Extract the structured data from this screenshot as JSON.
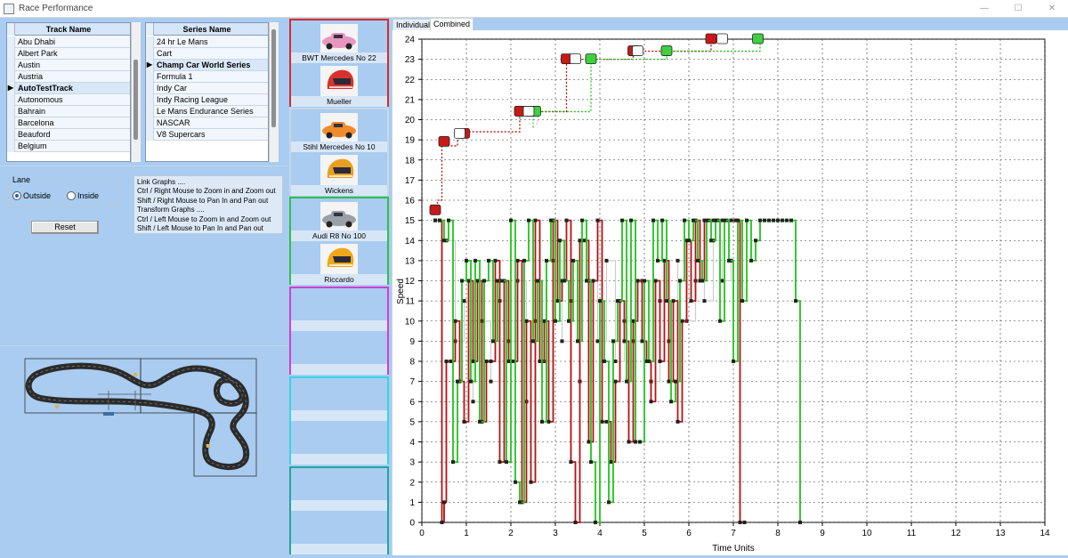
{
  "window": {
    "title": "Race Performance",
    "controls": [
      "—",
      "☐",
      "✕"
    ]
  },
  "track_list": {
    "header": "Track Name",
    "items": [
      "Abu Dhabi",
      "Albert Park",
      "Austin",
      "Austria",
      "AutoTestTrack",
      "Autonomous",
      "Bahrain",
      "Barcelona",
      "Beauford",
      "Belgium"
    ],
    "selected_index": 4
  },
  "series_list": {
    "header": "Series Name",
    "items": [
      "24 hr Le Mans",
      "Cart",
      "Champ Car World Series",
      "Formula 1",
      "Indy Car",
      "Indy Racing League",
      "Le Mans Endurance Series",
      "NASCAR",
      "V8 Supercars"
    ],
    "selected_index": 2
  },
  "lane": {
    "legend": "Lane",
    "options": [
      "Outside",
      "Inside"
    ],
    "selected": "Outside"
  },
  "reset_label": "Reset",
  "help_lines": [
    "Link Graphs ....",
    "Ctrl / Right Mouse to Zoom in and Zoom out",
    "Shift / Right Mouse to Pan In and Pan out",
    "Transform Graphs ....",
    "Ctrl / Left Mouse to Zoom in and Zoom out",
    "Shift / Left Mouse to Pan In and Pan out"
  ],
  "cars": [
    {
      "car": "BWT Mercedes No 22",
      "driver": "Mueller",
      "border": "#d62b2b",
      "car_color": "#e896c0",
      "helmet_color": "#d8322e"
    },
    {
      "car": "Stihl Mercedes No 10",
      "driver": "Wickens",
      "border": "#c9d7e6",
      "car_color": "#f08c2c",
      "helmet_color": "#e8a020"
    },
    {
      "car": "Audi R8 No 100",
      "driver": "Riccardo",
      "border": "#2ec24a",
      "car_color": "#9aa0a8",
      "helmet_color": "#f0a818"
    }
  ],
  "empty_slots": [
    {
      "border": "#d23fd2"
    },
    {
      "border": "#39d4e4"
    },
    {
      "border": "#21a6a0"
    }
  ],
  "tabs": [
    "Individual",
    "Combined"
  ],
  "active_tab": "Combined",
  "colors": {
    "background": "#a9ccf0",
    "series_red": "#b31212",
    "series_green": "#22c21e",
    "series_grey": "#c8cec8"
  },
  "chart_data": {
    "type": "line",
    "xlabel": "Time Units",
    "ylabel": "Speed",
    "xlim": [
      0,
      14
    ],
    "ylim": [
      0,
      24
    ],
    "xticks": [
      0,
      1,
      2,
      3,
      4,
      5,
      6,
      7,
      8,
      9,
      10,
      11,
      12,
      13,
      14
    ],
    "yticks": [
      0,
      1,
      2,
      3,
      4,
      5,
      6,
      7,
      8,
      9,
      10,
      11,
      12,
      13,
      14,
      15,
      16,
      17,
      18,
      19,
      20,
      21,
      22,
      23,
      24
    ],
    "grid": true,
    "series": [
      {
        "color": "#b31212",
        "x": [
          0.3,
          0.4,
          0.45,
          0.5,
          0.55,
          0.65,
          0.75,
          0.85,
          0.95,
          1.05,
          1.15,
          1.25,
          1.35,
          1.45,
          1.55,
          1.65,
          1.75,
          1.85,
          1.95,
          2.05,
          2.15,
          2.25,
          2.35,
          2.45,
          2.55,
          2.65,
          2.75,
          2.85,
          2.95,
          3.05,
          3.15,
          3.25,
          3.35,
          3.45,
          3.55,
          3.65,
          3.75,
          3.85,
          3.95,
          4.05,
          4.15,
          4.25,
          4.35,
          4.45,
          4.55,
          4.65,
          4.75,
          4.85,
          4.95,
          5.05,
          5.15,
          5.25,
          5.35,
          5.45,
          5.55,
          5.65,
          5.75,
          5.85,
          5.95,
          6.05,
          6.15,
          6.25,
          6.35,
          6.45,
          6.55,
          6.65,
          6.75,
          6.85,
          6.95,
          7.05,
          7.15,
          7.25
        ],
        "y": [
          15,
          15,
          0,
          1,
          8,
          8,
          10,
          7,
          5,
          12,
          8,
          12,
          5,
          8,
          8,
          13,
          3,
          12,
          8,
          8,
          13,
          1,
          10,
          2,
          15,
          8,
          10,
          5,
          15,
          11,
          12,
          15,
          3,
          0,
          14,
          14,
          4,
          12,
          15,
          5,
          5,
          3,
          7,
          11,
          9,
          4,
          10,
          12,
          9,
          8,
          6,
          12,
          8,
          13,
          7,
          11,
          5,
          10,
          14,
          11,
          15,
          12,
          15,
          15,
          15,
          15,
          15,
          15,
          15,
          15,
          0,
          0
        ]
      },
      {
        "color": "#22c21e",
        "x": [
          0.3,
          0.4,
          0.5,
          0.6,
          0.7,
          0.8,
          0.9,
          1.0,
          1.1,
          1.2,
          1.3,
          1.4,
          1.5,
          1.6,
          1.7,
          1.8,
          1.9,
          2.0,
          2.1,
          2.2,
          2.3,
          2.4,
          2.5,
          2.6,
          2.7,
          2.8,
          2.9,
          3.0,
          3.1,
          3.2,
          3.3,
          3.4,
          3.5,
          3.6,
          3.7,
          3.8,
          3.9,
          4.0,
          4.1,
          4.2,
          4.3,
          4.4,
          4.5,
          4.6,
          4.7,
          4.8,
          4.9,
          5.0,
          5.1,
          5.2,
          5.3,
          5.4,
          5.5,
          5.6,
          5.7,
          5.8,
          5.9,
          6.0,
          6.1,
          6.2,
          6.3,
          6.4,
          6.5,
          6.6,
          6.7,
          6.8,
          6.9,
          7.0,
          7.1,
          7.2,
          7.3,
          7.4,
          7.5,
          7.6,
          7.7,
          7.8,
          7.9,
          8.0,
          8.1,
          8.2,
          8.3,
          8.4,
          8.5
        ],
        "y": [
          15,
          15,
          14,
          15,
          3,
          7,
          12,
          13,
          7,
          13,
          5,
          12,
          13,
          9,
          12,
          12,
          3,
          15,
          2,
          1,
          13,
          15,
          9,
          12,
          5,
          13,
          15,
          10,
          14,
          12,
          10,
          13,
          9,
          15,
          12,
          3,
          0,
          11,
          8,
          1,
          9,
          11,
          15,
          7,
          15,
          4,
          4,
          12,
          8,
          15,
          13,
          15,
          11,
          6,
          7,
          12,
          15,
          14,
          15,
          13,
          12,
          15,
          14,
          15,
          10,
          15,
          13,
          8,
          15,
          11,
          15,
          13,
          14,
          15,
          15,
          15,
          15,
          15,
          15,
          15,
          15,
          11,
          0
        ]
      },
      {
        "color": "#c8cec8",
        "x": [
          0.55,
          0.75,
          0.95,
          1.15,
          1.35,
          1.55,
          1.75,
          1.95,
          2.15,
          2.35,
          2.55,
          2.75,
          2.95,
          3.15,
          3.35,
          3.55,
          3.75,
          3.95,
          4.15,
          4.35,
          4.55,
          4.75,
          4.95,
          5.15,
          5.35,
          5.55,
          5.75,
          5.95,
          6.15,
          6.35,
          6.55,
          6.75,
          6.95
        ],
        "y": [
          14,
          9,
          11,
          6,
          10,
          7,
          11,
          9,
          12,
          6,
          10,
          8,
          13,
          9,
          11,
          7,
          12,
          9,
          13,
          8,
          10,
          9,
          12,
          7,
          11,
          9,
          13,
          10,
          12,
          11,
          14,
          12,
          13
        ]
      }
    ],
    "annotations": {
      "red": [
        "",
        "",
        "",
        "",
        "",
        ""
      ],
      "green": [
        "",
        "",
        "",
        ""
      ]
    }
  }
}
